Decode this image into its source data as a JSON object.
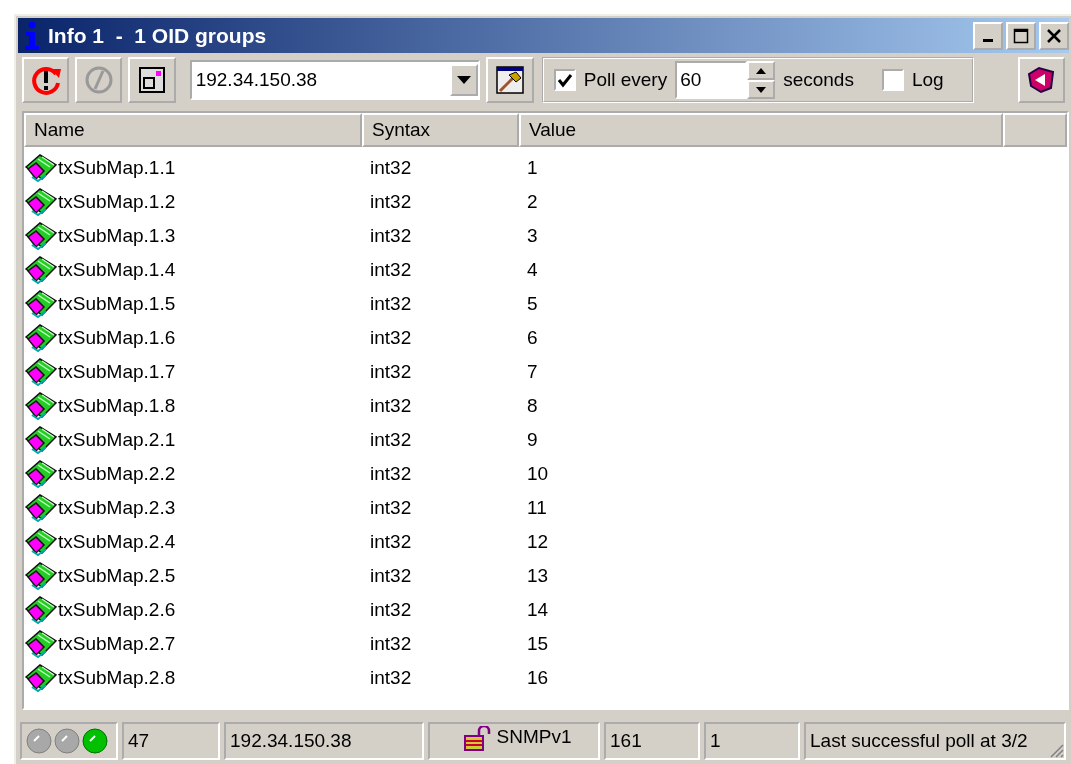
{
  "window": {
    "title": "Info 1  -  1 OID groups"
  },
  "toolbar": {
    "address": "192.34.150.38",
    "poll": {
      "checked": true,
      "label": "Poll every",
      "interval": "60",
      "unit": "seconds"
    },
    "log": {
      "checked": false,
      "label": "Log"
    }
  },
  "table": {
    "columns": [
      "Name",
      "Syntax",
      "Value"
    ],
    "rows": [
      {
        "name": "txSubMap.1.1",
        "syntax": "int32",
        "value": "1"
      },
      {
        "name": "txSubMap.1.2",
        "syntax": "int32",
        "value": "2"
      },
      {
        "name": "txSubMap.1.3",
        "syntax": "int32",
        "value": "3"
      },
      {
        "name": "txSubMap.1.4",
        "syntax": "int32",
        "value": "4"
      },
      {
        "name": "txSubMap.1.5",
        "syntax": "int32",
        "value": "5"
      },
      {
        "name": "txSubMap.1.6",
        "syntax": "int32",
        "value": "6"
      },
      {
        "name": "txSubMap.1.7",
        "syntax": "int32",
        "value": "7"
      },
      {
        "name": "txSubMap.1.8",
        "syntax": "int32",
        "value": "8"
      },
      {
        "name": "txSubMap.2.1",
        "syntax": "int32",
        "value": "9"
      },
      {
        "name": "txSubMap.2.2",
        "syntax": "int32",
        "value": "10"
      },
      {
        "name": "txSubMap.2.3",
        "syntax": "int32",
        "value": "11"
      },
      {
        "name": "txSubMap.2.4",
        "syntax": "int32",
        "value": "12"
      },
      {
        "name": "txSubMap.2.5",
        "syntax": "int32",
        "value": "13"
      },
      {
        "name": "txSubMap.2.6",
        "syntax": "int32",
        "value": "14"
      },
      {
        "name": "txSubMap.2.7",
        "syntax": "int32",
        "value": "15"
      },
      {
        "name": "txSubMap.2.8",
        "syntax": "int32",
        "value": "16"
      }
    ]
  },
  "status_bar": {
    "leds": [
      {
        "on": false
      },
      {
        "on": false
      },
      {
        "on": true
      }
    ],
    "count": "47",
    "address": "192.34.150.38",
    "protocol": "SNMPv1",
    "port": "161",
    "field_6": "1",
    "message": "Last successful poll at 3/2"
  }
}
